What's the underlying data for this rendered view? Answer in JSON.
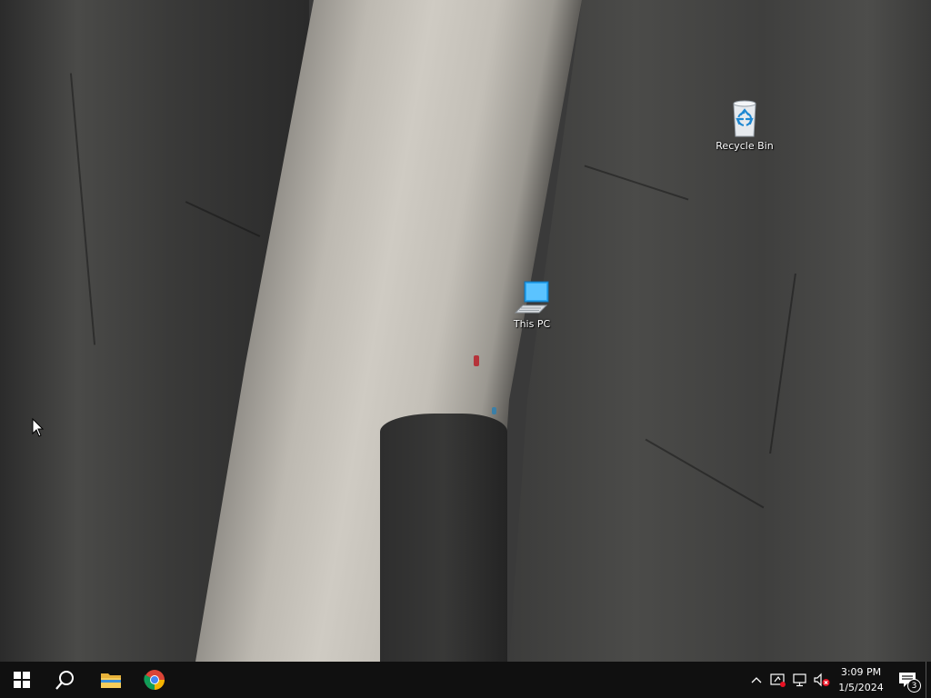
{
  "desktop": {
    "icons": [
      {
        "label": "Recycle Bin",
        "icon": "recycle-bin-icon"
      },
      {
        "label": "This PC",
        "icon": "computer-icon"
      }
    ]
  },
  "taskbar": {
    "start_icon": "windows-logo-icon",
    "search_icon": "search-icon",
    "pinned": [
      {
        "name": "File Explorer",
        "icon": "folder-icon"
      },
      {
        "name": "Google Chrome",
        "icon": "chrome-icon"
      }
    ],
    "tray": {
      "icons": [
        "chevron-up-icon",
        "network-alert-icon",
        "network-icon",
        "volume-muted-icon"
      ],
      "time": "3:09 PM",
      "date": "1/5/2024",
      "notification_count": "3"
    }
  },
  "colors": {
    "taskbar_bg": "#101010",
    "accent_blue": "#1e90ff"
  }
}
